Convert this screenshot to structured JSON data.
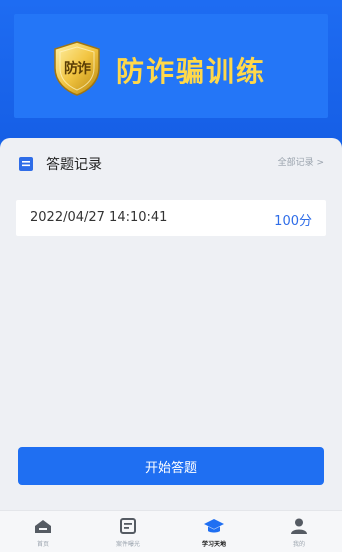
{
  "banner": {
    "badge_text": "防诈",
    "title": "防诈骗训练"
  },
  "records_section": {
    "title": "答题记录",
    "all_link": "全部记录 >",
    "items": [
      {
        "time": "2022/04/27 14:10:41",
        "score": "100分"
      }
    ]
  },
  "start_button": {
    "label": "开始答题"
  },
  "tabbar": {
    "items": [
      {
        "label": "首页",
        "icon": "home-icon"
      },
      {
        "label": "案件曝光",
        "icon": "case-exposure-icon"
      },
      {
        "label": "学习天地",
        "icon": "graduation-cap-icon",
        "active": true
      },
      {
        "label": "我的",
        "icon": "user-icon"
      }
    ]
  },
  "colors": {
    "primary": "#1f6ff2",
    "background": "#1562e8",
    "title_gold": "#ffd84a",
    "score_blue": "#2f6de8"
  }
}
